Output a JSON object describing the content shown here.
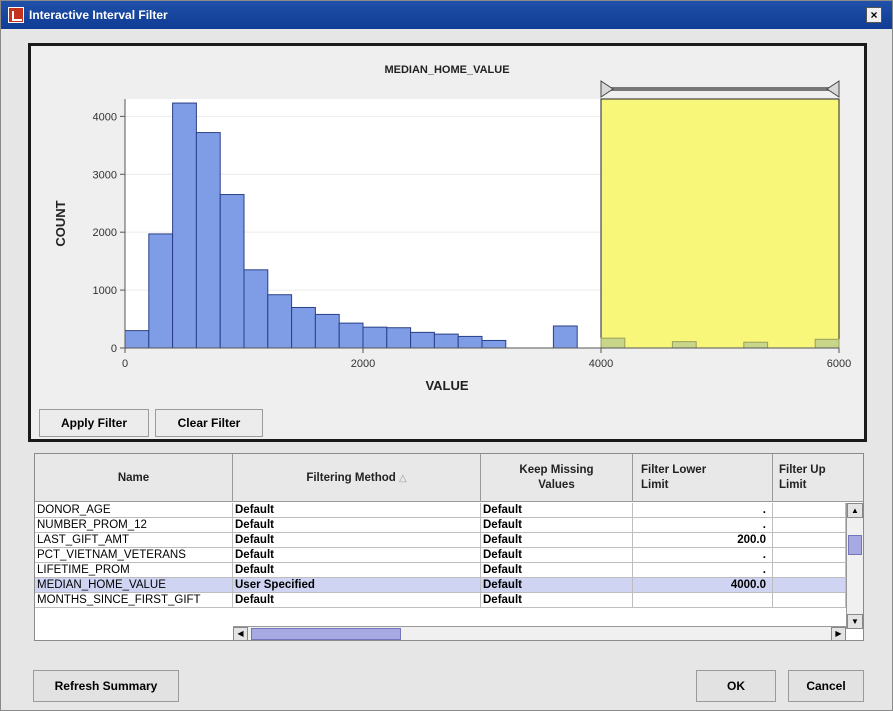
{
  "window": {
    "title": "Interactive Interval Filter",
    "close_label": "×"
  },
  "chart_buttons": {
    "apply": "Apply Filter",
    "clear": "Clear Filter"
  },
  "chart_data": {
    "type": "bar",
    "title": "MEDIAN_HOME_VALUE",
    "xlabel": "VALUE",
    "ylabel": "COUNT",
    "xlim": [
      0,
      6000
    ],
    "ylim": [
      0,
      4300
    ],
    "xticks": [
      0,
      2000,
      4000,
      6000
    ],
    "yticks": [
      0,
      1000,
      2000,
      3000,
      4000
    ],
    "bin_width": 200,
    "bins": [
      {
        "x": 0,
        "count": 300
      },
      {
        "x": 200,
        "count": 1970
      },
      {
        "x": 400,
        "count": 4230
      },
      {
        "x": 600,
        "count": 3720
      },
      {
        "x": 800,
        "count": 2650
      },
      {
        "x": 1000,
        "count": 1350
      },
      {
        "x": 1200,
        "count": 920
      },
      {
        "x": 1400,
        "count": 700
      },
      {
        "x": 1600,
        "count": 580
      },
      {
        "x": 1800,
        "count": 430
      },
      {
        "x": 2000,
        "count": 360
      },
      {
        "x": 2200,
        "count": 350
      },
      {
        "x": 2400,
        "count": 270
      },
      {
        "x": 2600,
        "count": 240
      },
      {
        "x": 2800,
        "count": 200
      },
      {
        "x": 3000,
        "count": 130
      },
      {
        "x": 3600,
        "count": 380
      },
      {
        "x": 4000,
        "count": 170
      },
      {
        "x": 4600,
        "count": 110
      },
      {
        "x": 5200,
        "count": 100
      },
      {
        "x": 5800,
        "count": 150
      }
    ],
    "filter_range": [
      4000,
      6000
    ],
    "colors": {
      "bar": "#7f9de6",
      "filtered_bar": "#c8d68a",
      "filter_region": "#f9f77a",
      "plot_bg": "#ffffff"
    }
  },
  "table": {
    "columns": [
      "Name",
      "Filtering Method",
      "Keep Missing Values",
      "Filter Lower Limit",
      "Filter Up Limit"
    ],
    "rows": [
      {
        "name": "DONOR_AGE",
        "method": "Default",
        "missing": "Default",
        "lower": "."
      },
      {
        "name": "NUMBER_PROM_12",
        "method": "Default",
        "missing": "Default",
        "lower": "."
      },
      {
        "name": "LAST_GIFT_AMT",
        "method": "Default",
        "missing": "Default",
        "lower": "200.0"
      },
      {
        "name": "PCT_VIETNAM_VETERANS",
        "method": "Default",
        "missing": "Default",
        "lower": "."
      },
      {
        "name": "LIFETIME_PROM",
        "method": "Default",
        "missing": "Default",
        "lower": "."
      },
      {
        "name": "MEDIAN_HOME_VALUE",
        "method": "User Specified",
        "missing": "Default",
        "lower": "4000.0"
      },
      {
        "name": "MONTHS_SINCE_FIRST_GIFT",
        "method": "Default",
        "missing": "Default",
        "lower": ""
      }
    ],
    "selected_row": "MEDIAN_HOME_VALUE"
  },
  "footer": {
    "refresh": "Refresh Summary",
    "ok": "OK",
    "cancel": "Cancel"
  }
}
